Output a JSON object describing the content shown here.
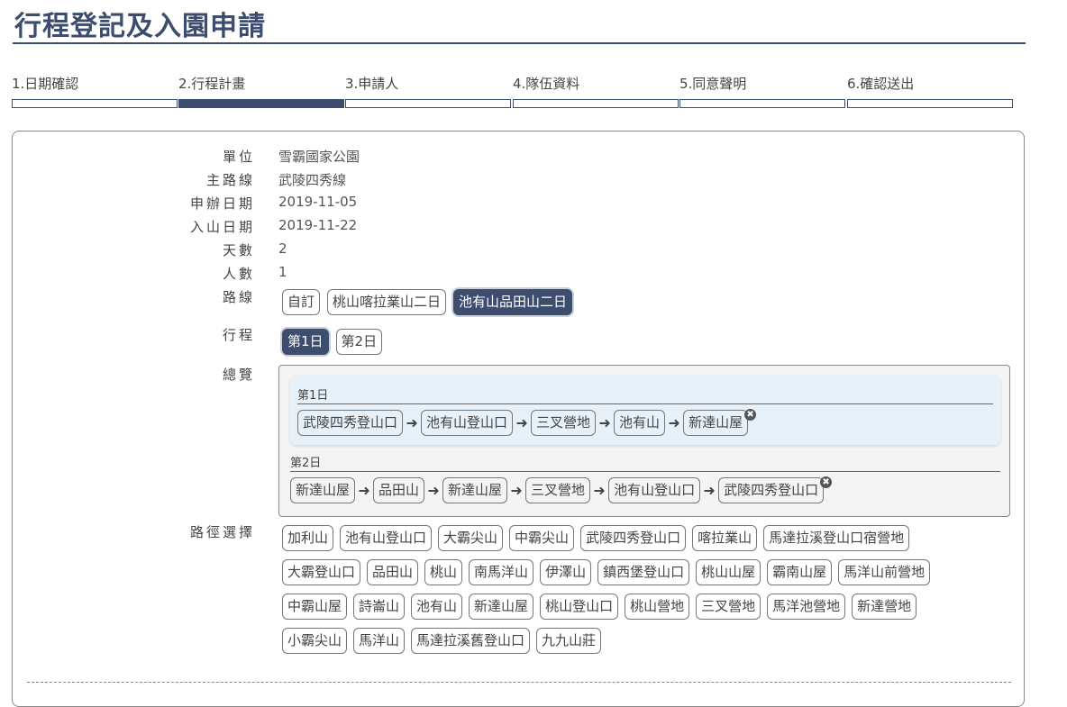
{
  "page": {
    "title": "行程登記及入園申請"
  },
  "steps": [
    {
      "label": "1.日期確認",
      "active": false
    },
    {
      "label": "2.行程計畫",
      "active": true
    },
    {
      "label": "3.申請人",
      "active": false
    },
    {
      "label": "4.隊伍資料",
      "active": false
    },
    {
      "label": "5.同意聲明",
      "active": false
    },
    {
      "label": "6.確認送出",
      "active": false
    }
  ],
  "info": {
    "unit_label": "單位",
    "unit": "雪霸國家公園",
    "route_label": "主路線",
    "route": "武陵四秀線",
    "apply_date_label": "申辦日期",
    "apply_date": "2019-11-05",
    "enter_date_label": "入山日期",
    "enter_date": "2019-11-22",
    "days_label": "天數",
    "days": "2",
    "people_label": "人數",
    "people": "1"
  },
  "paths": {
    "label": "路線",
    "options": [
      "自訂",
      "桃山喀拉業山二日",
      "池有山品田山二日"
    ],
    "selected": "池有山品田山二日"
  },
  "itinerary": {
    "label": "行程",
    "days": [
      "第1日",
      "第2日"
    ],
    "selected": "第1日"
  },
  "overview": {
    "label": "總覽",
    "day1": {
      "title": "第1日",
      "stops": [
        "武陵四秀登山口",
        "池有山登山口",
        "三叉營地",
        "池有山",
        "新達山屋"
      ]
    },
    "day2": {
      "title": "第2日",
      "stops": [
        "新達山屋",
        "品田山",
        "新達山屋",
        "三叉營地",
        "池有山登山口",
        "武陵四秀登山口"
      ]
    },
    "arrow": "➜",
    "remove": "✖"
  },
  "path_select": {
    "label": "路徑選擇",
    "rows": [
      [
        "加利山",
        "池有山登山口",
        "大霸尖山",
        "中霸尖山",
        "武陵四秀登山口",
        "喀拉業山",
        "馬達拉溪登山口宿營地"
      ],
      [
        "大霸登山口",
        "品田山",
        "桃山",
        "南馬洋山",
        "伊澤山",
        "鎮西堡登山口",
        "桃山山屋",
        "霸南山屋",
        "馬洋山前營地"
      ],
      [
        "中霸山屋",
        "詩崙山",
        "池有山",
        "新達山屋",
        "桃山登山口",
        "桃山營地",
        "三叉營地",
        "馬洋池營地",
        "新達營地"
      ],
      [
        "小霸尖山",
        "馬洋山",
        "馬達拉溪舊登山口",
        "九九山莊"
      ]
    ]
  }
}
